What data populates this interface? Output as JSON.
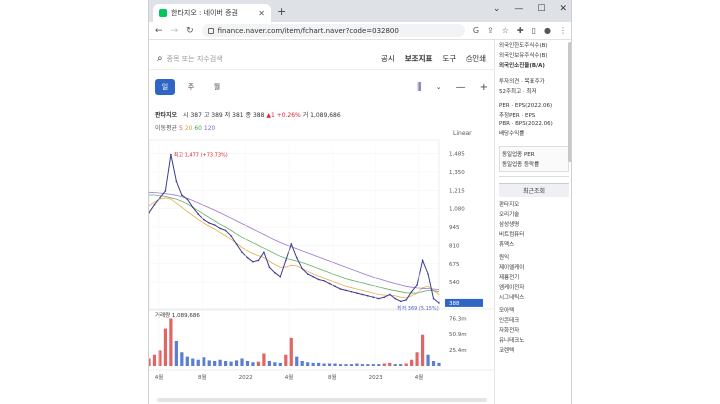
{
  "browser": {
    "tab_title": "한타지오 : 네이버 증권",
    "url": "finance.naver.com/item/fchart.naver?code=032800"
  },
  "toolbar": {
    "search_placeholder": "종목 또는 지수검색",
    "menu": [
      "공시",
      "보조지표",
      "도구",
      "인쇄"
    ]
  },
  "periods": [
    "일",
    "주",
    "월"
  ],
  "active_period": "일",
  "quote": {
    "name": "판타지오",
    "open_label": "시",
    "open": "387",
    "high_label": "고",
    "high": "389",
    "low_label": "저",
    "low": "381",
    "close_label": "종",
    "close": "388",
    "change": "▲1 +0.26%",
    "volume_label": "거",
    "volume": "1,089,686"
  },
  "moving_avg": {
    "label": "이동평균",
    "periods": [
      "5",
      "20",
      "60",
      "120"
    ]
  },
  "scale_mode": "Linear",
  "chart_data": {
    "type": "line",
    "price_axis_ticks": [
      "1,485",
      "1,350",
      "1,215",
      "1,080",
      "945",
      "810",
      "675",
      "540",
      "388"
    ],
    "volume_axis_ticks": [
      "76.3m",
      "50.9m",
      "25.4m"
    ],
    "x_ticks": [
      "4월",
      "8월",
      "2022",
      "4월",
      "8월",
      "2023",
      "4월"
    ],
    "ylim": [
      380,
      1540
    ],
    "high_annotation": "최고 1,477 (+73.73%)",
    "low_annotation": "최저 369 (5.15%)",
    "last_price": "388",
    "volume_label": "거래량 1,089,686",
    "series": [
      {
        "values": [
          1050,
          1110,
          1160,
          1210,
          1477,
          1280,
          1180,
          1150,
          1090,
          1040,
          1000,
          975,
          960,
          935,
          920,
          880,
          820,
          760,
          720,
          690,
          700,
          760,
          650,
          610,
          580,
          700,
          820,
          720,
          640,
          600,
          580,
          560,
          550,
          530,
          510,
          490,
          480,
          470,
          460,
          450,
          440,
          430,
          420,
          430,
          450,
          420,
          400,
          410,
          470,
          520,
          700,
          600,
          420,
          388
        ],
        "color": "#3b3b8f"
      }
    ],
    "ma_series": [
      {
        "values": [
          1100,
          1130,
          1150,
          1160,
          1150,
          1120,
          1090,
          1060,
          1030,
          1000,
          975,
          950,
          930,
          905,
          880,
          855,
          825,
          795,
          770,
          750,
          735,
          720,
          695,
          670,
          650,
          650,
          665,
          660,
          640,
          620,
          600,
          585,
          570,
          555,
          540,
          525,
          510,
          500,
          490,
          480,
          470,
          460,
          450,
          445,
          445,
          440,
          430,
          425,
          440,
          460,
          500,
          510,
          480,
          450
        ],
        "color": "#e2a030"
      },
      {
        "values": [
          1180,
          1180,
          1175,
          1170,
          1160,
          1150,
          1135,
          1115,
          1090,
          1065,
          1040,
          1015,
          990,
          965,
          945,
          920,
          895,
          870,
          850,
          830,
          810,
          790,
          770,
          750,
          730,
          715,
          705,
          695,
          685,
          670,
          655,
          640,
          625,
          610,
          595,
          580,
          565,
          555,
          545,
          535,
          525,
          515,
          505,
          495,
          485,
          478,
          470,
          462,
          460,
          460,
          470,
          480,
          478,
          470
        ],
        "color": "#4ca24c"
      },
      {
        "values": [
          1200,
          1198,
          1195,
          1190,
          1185,
          1178,
          1168,
          1155,
          1140,
          1122,
          1104,
          1086,
          1068,
          1050,
          1030,
          1010,
          990,
          970,
          950,
          930,
          910,
          890,
          870,
          850,
          832,
          815,
          800,
          785,
          770,
          755,
          740,
          725,
          710,
          695,
          680,
          665,
          650,
          635,
          620,
          605,
          590,
          577,
          565,
          553,
          541,
          530,
          520,
          510,
          503,
          498,
          495,
          493,
          490,
          486
        ],
        "color": "#8a5cc8"
      }
    ],
    "volume": [
      12,
      18,
      25,
      60,
      76,
      40,
      22,
      15,
      12,
      10,
      14,
      9,
      8,
      10,
      8,
      7,
      9,
      12,
      8,
      6,
      7,
      20,
      8,
      6,
      5,
      18,
      45,
      15,
      8,
      6,
      5,
      5,
      4,
      4,
      4,
      3,
      3,
      3,
      4,
      3,
      3,
      3,
      3,
      4,
      5,
      3,
      3,
      4,
      10,
      22,
      50,
      18,
      8,
      5
    ],
    "volume_ylim": [
      0,
      80
    ]
  },
  "right_panel": {
    "top_items": [
      "외국인한도주식수(B)",
      "외국인보유주식수(B)",
      "외국인소진율(B/A)"
    ],
    "mid_items": [
      "투자의견 · 목표주가",
      "52주최고 · 최저"
    ],
    "per_items": [
      "PER · EPS(2022.06)",
      "추정PER · EPS",
      "PBR · BPS(2022.06)",
      "배당수익률"
    ],
    "industry_items": [
      "동일업종 PER",
      "동일업종 등락률"
    ],
    "recent_header": "최근조회",
    "recent_items": [
      "판타지오",
      "오리기술",
      "삼성생명",
      "비트컴퓨터",
      "휴맥스",
      "",
      "원익",
      "제이엘케이",
      "제룡전기",
      "엠케이전자",
      "시그네틱스",
      "",
      "모아텍",
      "인콘테크",
      "자화전자",
      "유니테크노",
      "코렌텍"
    ]
  }
}
